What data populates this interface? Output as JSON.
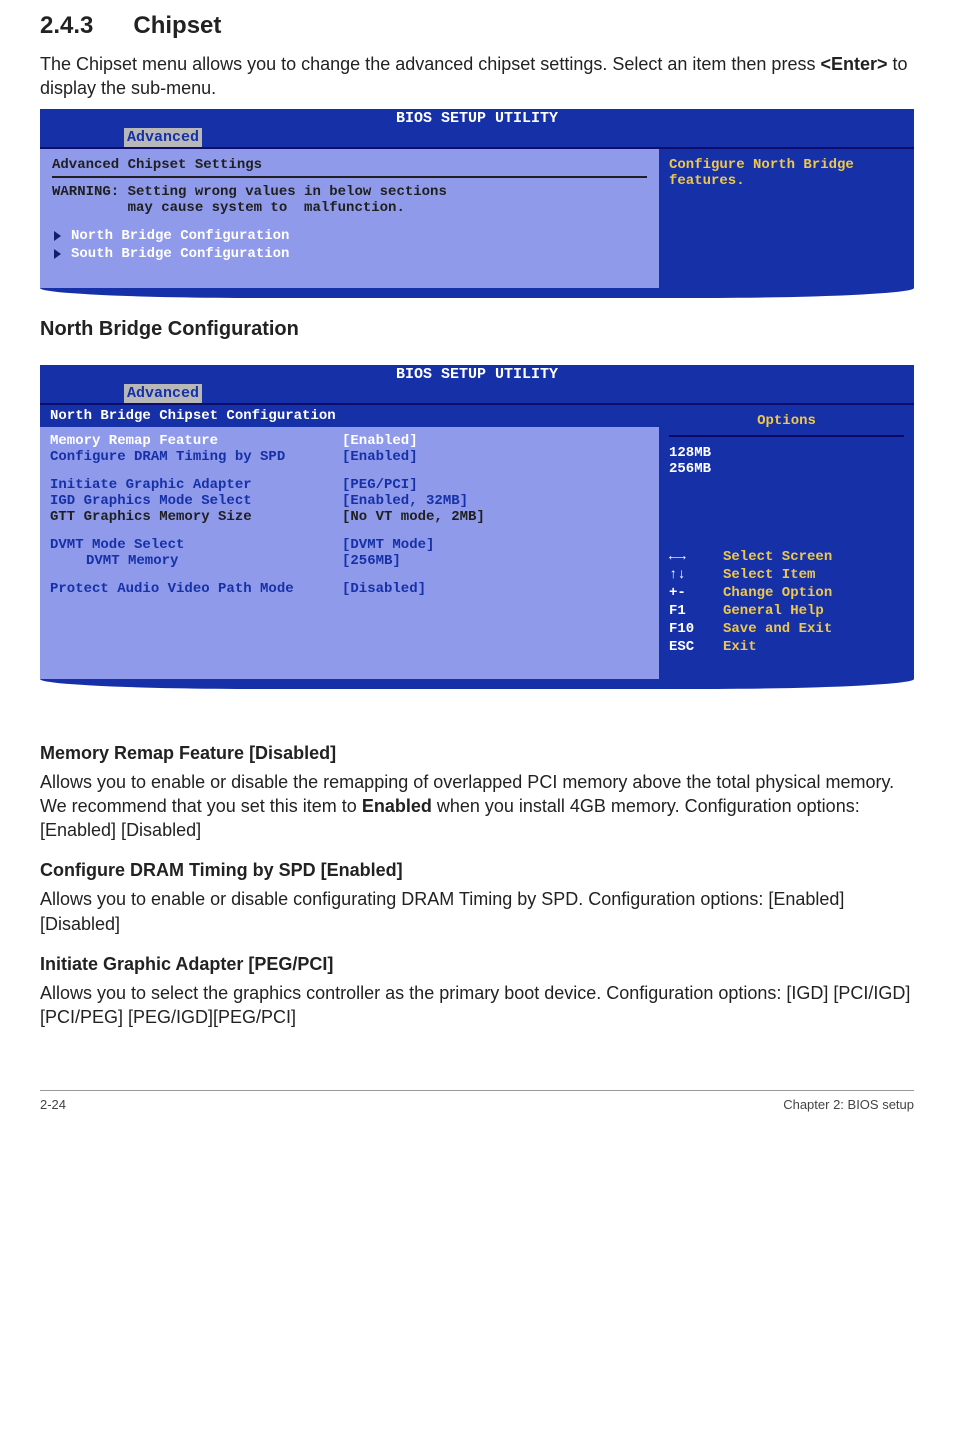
{
  "heading": {
    "num": "2.4.3",
    "title": "Chipset"
  },
  "intro": {
    "line1": "The Chipset menu allows you to change the advanced chipset settings. Select an item then press ",
    "key": "<Enter>",
    "line2": " to display the sub-menu."
  },
  "bios1": {
    "windowTitle": "BIOS SETUP UTILITY",
    "tab": "Advanced",
    "title": "Advanced Chipset Settings",
    "warn1": "WARNING: Setting wrong values in below sections",
    "warn2": "         may cause system to  malfunction.",
    "items": [
      "North Bridge Configuration",
      "South Bridge Configuration"
    ],
    "rightLine1": "Configure North Bridge",
    "rightLine2": "features."
  },
  "section1": "North Bridge Configuration",
  "bios2": {
    "windowTitle": "BIOS SETUP UTILITY",
    "tab": "Advanced",
    "title": "North Bridge Chipset Configuration",
    "rows": [
      {
        "name": "Memory Remap Feature",
        "val": "[Enabled]",
        "cls": "hl"
      },
      {
        "name": "Configure DRAM Timing by SPD",
        "val": "[Enabled]",
        "cls": "blue"
      },
      {
        "name": "",
        "val": "",
        "cls": "blk"
      },
      {
        "name": "Initiate Graphic Adapter",
        "val": "[PEG/PCI]",
        "cls": "blue"
      },
      {
        "name": "IGD Graphics Mode Select",
        "val": "[Enabled, 32MB]",
        "cls": "blue"
      },
      {
        "name": "GTT Graphics Memory Size",
        "val": "[No VT mode, 2MB]",
        "cls": "norm"
      },
      {
        "name": "",
        "val": "",
        "cls": "blk"
      },
      {
        "name": "DVMT Mode Select",
        "val": "[DVMT Mode]",
        "cls": "blue"
      },
      {
        "name": "DVMT Memory",
        "val": "[256MB]",
        "cls": "blue",
        "indent": true
      },
      {
        "name": "",
        "val": "",
        "cls": "blk"
      },
      {
        "name": "Protect Audio Video Path Mode",
        "val": "[Disabled]",
        "cls": "blue"
      }
    ],
    "optionsTitle": "Options",
    "options": [
      "128MB",
      "256MB"
    ],
    "nav": [
      {
        "key": "←→",
        "label": "Select Screen"
      },
      {
        "key": "↑↓",
        "label": "Select Item"
      },
      {
        "key": "+-",
        "label": "Change Option"
      },
      {
        "key": "F1",
        "label": "General Help"
      },
      {
        "key": "F10",
        "label": "Save and Exit"
      },
      {
        "key": "ESC",
        "label": "Exit"
      }
    ]
  },
  "sec_mem": {
    "h": "Memory Remap Feature [Disabled]",
    "p1a": "Allows you to enable or disable the  remapping of overlapped PCI memory above the total physical memory. We recommend that you set this item to ",
    "bold": "Enabled",
    "p1b": " when you install 4GB memory. Configuration options: [Enabled] [Disabled]"
  },
  "sec_dram": {
    "h": "Configure DRAM Timing by SPD [Enabled]",
    "p": "Allows you to enable or disable configurating DRAM Timing by SPD. Configuration options: [Enabled] [Disabled]"
  },
  "sec_iga": {
    "h": "Initiate Graphic Adapter [PEG/PCI]",
    "p": "Allows you to select the graphics controller as the primary boot device. Configuration options: [IGD] [PCI/IGD] [PCI/PEG] [PEG/IGD][PEG/PCI]"
  },
  "footer": {
    "left": "2-24",
    "right": "Chapter 2: BIOS setup"
  }
}
